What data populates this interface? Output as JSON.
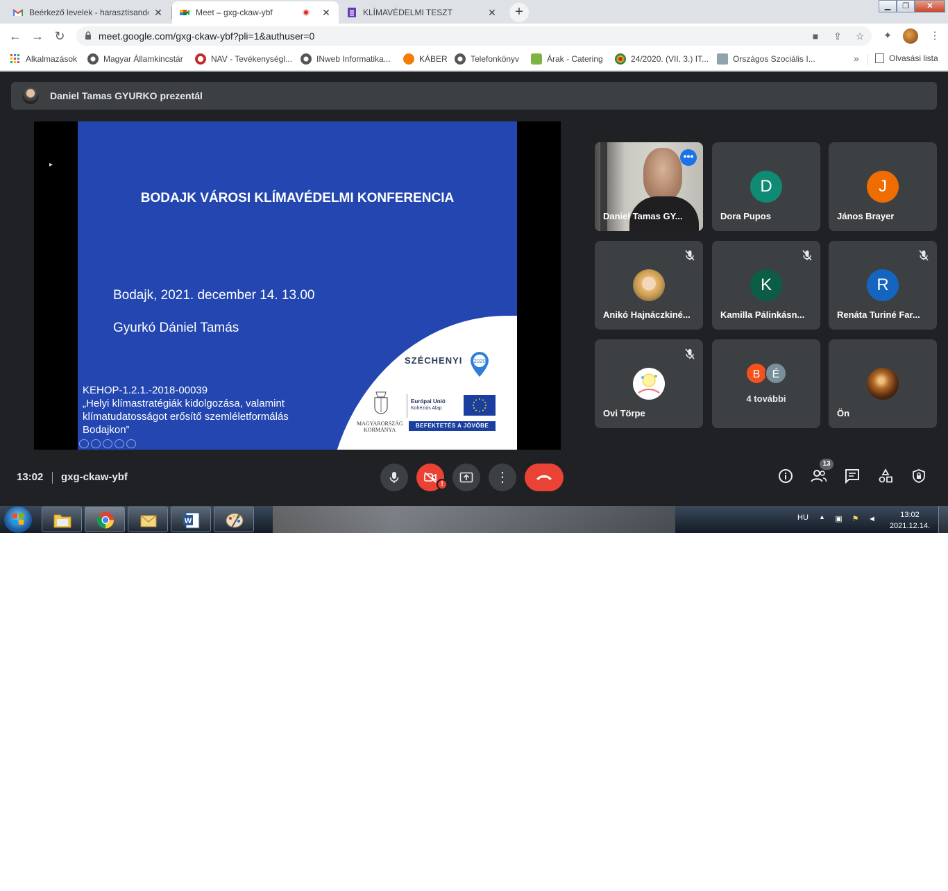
{
  "browser": {
    "tabs": [
      {
        "title": "Beérkező levelek - harasztisando",
        "favicon": "gmail-icon"
      },
      {
        "title": "Meet – gxg-ckaw-ybf",
        "favicon": "meet-icon",
        "recording": true
      },
      {
        "title": "KLÍMAVÉDELMI TESZT",
        "favicon": "forms-icon"
      }
    ],
    "address_bar": {
      "url": "meet.google.com/gxg-ckaw-ybf?pli=1&authuser=0"
    },
    "bookmarks": [
      {
        "label": "Alkalmazások",
        "icon": "apps-grid-icon"
      },
      {
        "label": "Magyar Államkincstár",
        "icon": "globe-icon"
      },
      {
        "label": "NAV - Tevékenységl...",
        "icon": "nav-icon"
      },
      {
        "label": "INweb Informatika...",
        "icon": "globe-icon"
      },
      {
        "label": "KÁBER",
        "icon": "kaber-icon"
      },
      {
        "label": "Telefonkönyv",
        "icon": "globe-icon"
      },
      {
        "label": "Árak - Catering",
        "icon": "catering-icon"
      },
      {
        "label": "24/2020. (VII. 3.) IT...",
        "icon": "gov-icon"
      },
      {
        "label": "Országos Szociális I...",
        "icon": "site-icon"
      }
    ],
    "reading_list": "Olvasási lista",
    "more_bookmarks": "»"
  },
  "meet": {
    "presenter_banner": "Daniel Tamas GYURKO prezentál",
    "slide": {
      "title": "BODAJK VÁROSI KLÍMAVÉDELMI KONFERENCIA",
      "date": "Bodajk, 2021. december 14. 13.00",
      "author": "Gyurkó Dániel Tamás",
      "project_lines": [
        "KEHOP-1.2.1.-2018-00039",
        "„Helyi klímastratégiák kidolgozása, valamint",
        "klímatudatosságot erősítő szemléletformálás",
        "Bodajkon”"
      ],
      "szechenyi": "SZÉCHENYI",
      "szechenyi_year": "2020",
      "govt_line1": "MAGYARORSZÁG",
      "govt_line2": "KORMÁNYA",
      "eu_line1": "Európai Unió",
      "eu_line2": "Kohéziós Alap",
      "invest_banner": "BEFEKTETÉS A JÖVŐBE"
    },
    "participants": [
      {
        "name": "Daniel Tamas GY...",
        "type": "video",
        "speaking": true
      },
      {
        "name": "Dora Pupos",
        "initial": "D",
        "color": "#0f8a73",
        "muted": false
      },
      {
        "name": "János Brayer",
        "initial": "J",
        "color": "#ef6c00",
        "muted": false
      },
      {
        "name": "Anikó Hajnáczkiné...",
        "type": "photo",
        "muted": true
      },
      {
        "name": "Kamilla Pálinkásn...",
        "initial": "K",
        "color": "#0b5e45",
        "muted": true
      },
      {
        "name": "Renáta Turiné Far...",
        "initial": "R",
        "color": "#1565c0",
        "muted": true
      },
      {
        "name": "Ovi Törpe",
        "type": "logo",
        "muted": true
      },
      {
        "name": "4 további",
        "type": "more",
        "initials": [
          "B",
          "É"
        ],
        "colors": [
          "#f4511e",
          "#78909c"
        ]
      },
      {
        "name": "Ön",
        "type": "photo-self"
      }
    ],
    "bottom_bar": {
      "time": "13:02",
      "meeting_code": "gxg-ckaw-ybf",
      "participant_count": "13"
    }
  },
  "taskbar": {
    "language": "HU",
    "time": "13:02",
    "date": "2021.12.14."
  }
}
